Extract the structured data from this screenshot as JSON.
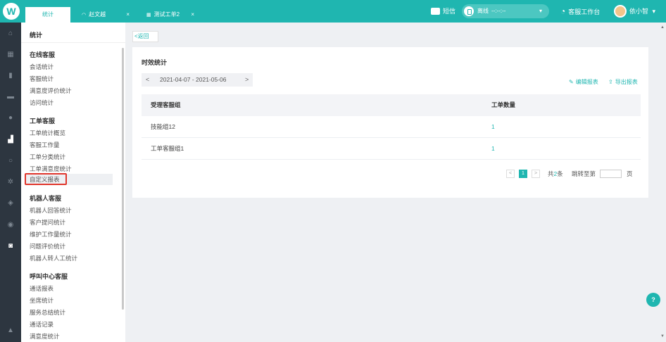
{
  "topbar": {
    "tabs": [
      {
        "label": "统计",
        "active": true
      },
      {
        "label": "赵文越",
        "icon": "headset-icon"
      },
      {
        "label": "测试工单2",
        "icon": "ticket-icon"
      }
    ],
    "close_glyph": "×",
    "sms_label": "短信",
    "status_label": "离线",
    "status_timer": "--:--:--",
    "status_caret": "▾",
    "workbench_label": "客服工作台",
    "user_name": "依小智",
    "user_caret": "▾"
  },
  "menu": {
    "title": "统计",
    "groups": [
      {
        "label": "在线客服",
        "items": [
          "会话统计",
          "客服统计",
          "满意度评价统计",
          "访问统计"
        ]
      },
      {
        "label": "工单客服",
        "items": [
          "工单统计概览",
          "客服工作量",
          "工单分类统计",
          "工单满意度统计",
          "自定义报表"
        ]
      },
      {
        "label": "机器人客服",
        "items": [
          "机器人回答统计",
          "客户提问统计",
          "维护工作量统计",
          "问题评价统计",
          "机器人转人工统计"
        ]
      },
      {
        "label": "呼叫中心客服",
        "items": [
          "通话报表",
          "坐席统计",
          "服务总结统计",
          "通话记录",
          "满意度统计"
        ]
      }
    ],
    "selected": "自定义报表"
  },
  "main": {
    "back_label": "<返回",
    "panel_title": "时效统计",
    "date_range": "2021-04-07 - 2021-05-06",
    "prev_glyph": "<",
    "next_glyph": ">",
    "edit_report": "编辑报表",
    "export_report": "导出报表",
    "table": {
      "headers": [
        "受理客服组",
        "工单数量"
      ],
      "rows": [
        [
          "技能组12",
          "1"
        ],
        [
          "工单客服组1",
          "1"
        ]
      ]
    },
    "pager": {
      "current_page": "1",
      "total_prefix": "共",
      "total_count": "2",
      "total_suffix": "条",
      "jump_label": "跳转至第",
      "page_unit": "页",
      "prev_glyph": "<",
      "next_glyph": ">"
    }
  },
  "help_label": "?",
  "colors": {
    "accent": "#1fb6b0",
    "rail": "#2d3640",
    "highlight": "#e0362c"
  }
}
